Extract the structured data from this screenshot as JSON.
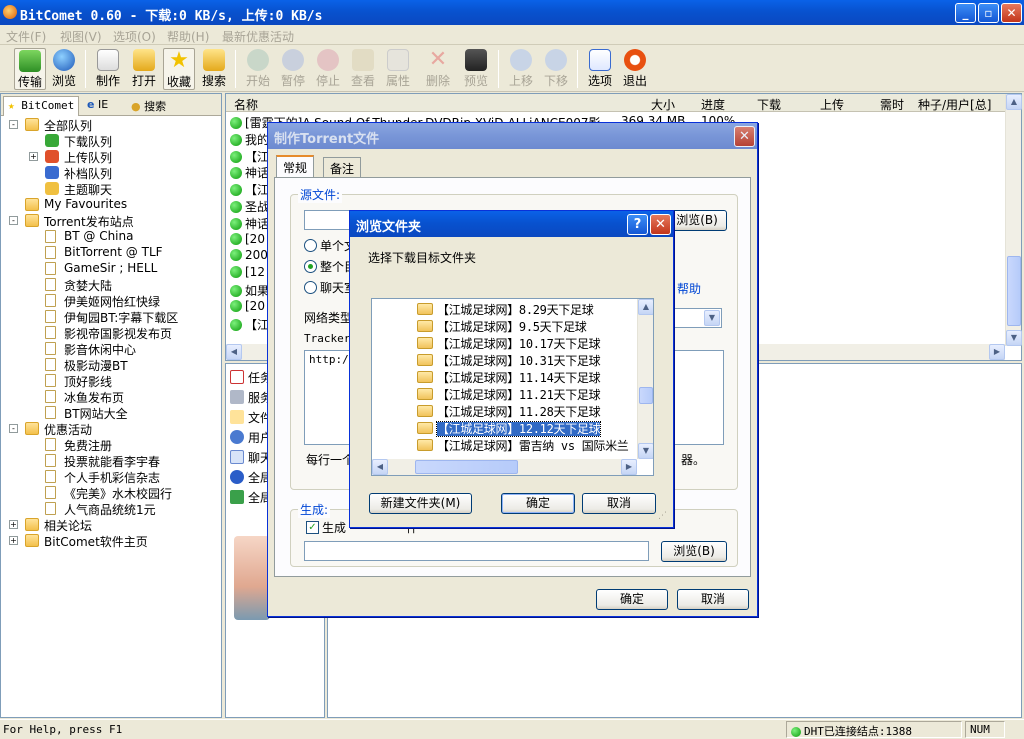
{
  "window": {
    "title": "BitComet 0.60 - 下载:0 KB/s, 上传:0 KB/s"
  },
  "menu": [
    "文件(F)",
    "视图(V)",
    "选项(O)",
    "帮助(H)",
    "最新优惠活动"
  ],
  "toolbar": [
    "传输",
    "浏览",
    "制作",
    "打开",
    "收藏",
    "搜索",
    "开始",
    "暂停",
    "停止",
    "查看",
    "属性",
    "删除",
    "预览",
    "上移",
    "下移",
    "选项",
    "退出"
  ],
  "left_tabs": [
    "BitComet",
    "IE",
    "搜索"
  ],
  "tree": [
    {
      "label": "全部队列",
      "level": 0,
      "exp": "-",
      "icon": "folder"
    },
    {
      "label": "下载队列",
      "level": 1,
      "icon": "download"
    },
    {
      "label": "上传队列",
      "level": 1,
      "exp": "+",
      "icon": "upload"
    },
    {
      "label": "补档队列",
      "level": 1,
      "icon": "archive"
    },
    {
      "label": "主题聊天",
      "level": 1,
      "icon": "chat"
    },
    {
      "label": "My Favourites",
      "level": 0,
      "icon": "folder"
    },
    {
      "label": "Torrent发布站点",
      "level": 0,
      "exp": "-",
      "icon": "folder"
    },
    {
      "label": "BT @ China",
      "level": 1,
      "icon": "page"
    },
    {
      "label": "BitTorrent @ TLF",
      "level": 1,
      "icon": "page"
    },
    {
      "label": "GameSir ; HELL",
      "level": 1,
      "icon": "page"
    },
    {
      "label": "贪婪大陆",
      "level": 1,
      "icon": "page"
    },
    {
      "label": "伊美姬网怡红快绿",
      "level": 1,
      "icon": "page"
    },
    {
      "label": "伊甸园BT:字幕下载区",
      "level": 1,
      "icon": "page"
    },
    {
      "label": "影视帝国影视发布页",
      "level": 1,
      "icon": "page"
    },
    {
      "label": "影音休闲中心",
      "level": 1,
      "icon": "page"
    },
    {
      "label": "极影动漫BT",
      "level": 1,
      "icon": "page"
    },
    {
      "label": "顶好影线",
      "level": 1,
      "icon": "page"
    },
    {
      "label": "冰鱼发布页",
      "level": 1,
      "icon": "page"
    },
    {
      "label": "BT网站大全",
      "level": 1,
      "icon": "page"
    },
    {
      "label": "优惠活动",
      "level": 0,
      "exp": "-",
      "icon": "folder"
    },
    {
      "label": "免费注册",
      "level": 1,
      "icon": "page"
    },
    {
      "label": "投票就能看李宇春",
      "level": 1,
      "icon": "page"
    },
    {
      "label": "个人手机彩信杂志",
      "level": 1,
      "icon": "page"
    },
    {
      "label": "《完美》水木校园行",
      "level": 1,
      "icon": "page"
    },
    {
      "label": "人气商品统统1元",
      "level": 1,
      "icon": "page"
    },
    {
      "label": "相关论坛",
      "level": 0,
      "exp": "+",
      "icon": "folder"
    },
    {
      "label": "BitComet软件主页",
      "level": 0,
      "exp": "+",
      "icon": "folder"
    }
  ],
  "list": {
    "headers": [
      "名称",
      "大小",
      "进度",
      "下载",
      "上传",
      "需时",
      "种子/用户[总]"
    ],
    "rows": [
      {
        "name": "[雷霆下的]A.Sound.Of.Thunder.DVDRip.XViD-ALLiANCE007影",
        "size": "369.34 MB",
        "progress": "100%"
      },
      {
        "name": "我的"
      },
      {
        "name": "【江"
      },
      {
        "name": "神话"
      },
      {
        "name": "【江"
      },
      {
        "name": "圣战"
      },
      {
        "name": "神话"
      },
      {
        "name": "[20"
      },
      {
        "name": "200"
      },
      {
        "name": "[12"
      },
      {
        "name": "如果"
      },
      {
        "name": "[20"
      },
      {
        "name": "【江"
      }
    ]
  },
  "details": [
    "任务",
    "服务",
    "文件",
    "用户",
    "聊天",
    "全局",
    "全局"
  ],
  "status": {
    "help": "For Help, press F1",
    "dht": "DHT已连接结点:1388",
    "num": "NUM"
  },
  "make_dialog": {
    "title": "制作Torrent文件",
    "tabs": [
      "常规",
      "备注"
    ],
    "source_label": "源文件:",
    "radio_single": "单个文",
    "radio_dir": "整个目",
    "radio_chat": "聊天室",
    "help_link": "帮助",
    "browse": "浏览(B)",
    "net_type": "网络类型",
    "tracker_label": "Tracker",
    "tracker_value": "http://",
    "per_line": "每行一个",
    "per_line_tail": "器。",
    "gen_label": "生成:",
    "gen_check": "生成",
    "gen_tail": "件",
    "ok": "确定",
    "cancel": "取消"
  },
  "browse_dialog": {
    "title": "浏览文件夹",
    "prompt": "选择下载目标文件夹",
    "folders": [
      "【江城足球网】8.29天下足球",
      "【江城足球网】9.5天下足球",
      "【江城足球网】10.17天下足球",
      "【江城足球网】10.31天下足球",
      "【江城足球网】11.14天下足球",
      "【江城足球网】11.21天下足球",
      "【江城足球网】11.28天下足球",
      "【江城足球网】12.12天下足球",
      "【江城足球网】雷吉纳 vs 国际米兰"
    ],
    "selected_index": 7,
    "new_folder": "新建文件夹(M)",
    "ok": "确定",
    "cancel": "取消"
  }
}
